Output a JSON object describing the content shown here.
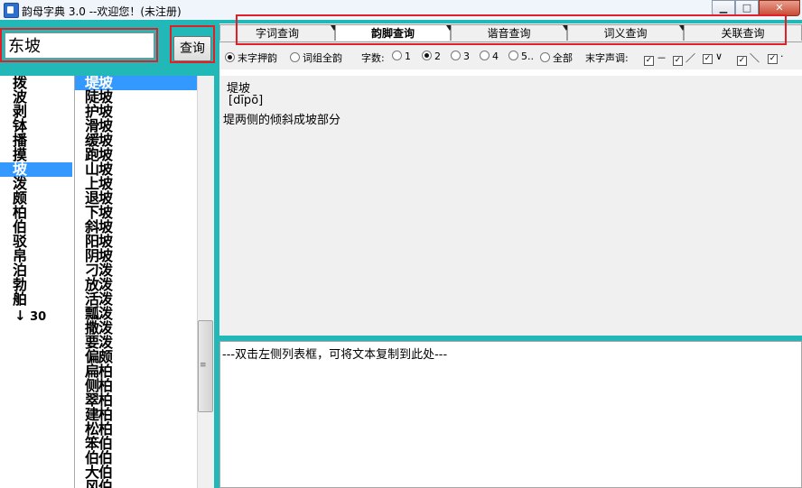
{
  "window": {
    "title": "韵母字典 3.0 --欢迎您！(未注册)",
    "controls": {
      "minimize": "▁",
      "maximize": "□",
      "close": "✕"
    }
  },
  "search": {
    "value": "东坡",
    "button_label": "查询"
  },
  "tabs": [
    {
      "label": "字词查询",
      "active": false
    },
    {
      "label": "韵脚查询",
      "active": true
    },
    {
      "label": "谐音查询",
      "active": false
    },
    {
      "label": "词义查询",
      "active": false
    },
    {
      "label": "关联查询",
      "active": false
    }
  ],
  "options": {
    "rhyme_mode": [
      {
        "label": "末字押韵",
        "selected": true
      },
      {
        "label": "词组全韵",
        "selected": false
      }
    ],
    "char_count_label": "字数:",
    "char_count": [
      {
        "label": "1",
        "selected": false
      },
      {
        "label": "2",
        "selected": true
      },
      {
        "label": "3",
        "selected": false
      },
      {
        "label": "4",
        "selected": false
      },
      {
        "label": "5..",
        "selected": false
      },
      {
        "label": "全部",
        "selected": false
      }
    ],
    "tone_label": "末字声调:",
    "tones": [
      {
        "symbol": "－",
        "checked": true
      },
      {
        "symbol": "／",
        "checked": true
      },
      {
        "symbol": "∨",
        "checked": true
      },
      {
        "symbol": "＼",
        "checked": true
      },
      {
        "symbol": "·",
        "checked": true
      }
    ]
  },
  "rhyme_list": {
    "items": [
      "拨",
      "波",
      "剥",
      "钵",
      "播",
      "摸",
      "坡",
      "泼",
      "颇",
      "柏",
      "伯",
      "驳",
      "帛",
      "泊",
      "勃",
      "舶"
    ],
    "selected_index": 6,
    "more_label": "30"
  },
  "word_list": {
    "items": [
      "堤坡",
      "陡坡",
      "护坡",
      "滑坡",
      "缓坡",
      "跑坡",
      "山坡",
      "上坡",
      "退坡",
      "下坡",
      "斜坡",
      "阳坡",
      "阴坡",
      "刁泼",
      "放泼",
      "活泼",
      "瓢泼",
      "撒泼",
      "要泼",
      "偏颇",
      "扁柏",
      "侧柏",
      "翠柏",
      "建柏",
      "松柏",
      "笨伯",
      "伯伯",
      "大伯",
      "风伯"
    ],
    "selected_index": 0
  },
  "detail": {
    "word": "堤坡",
    "pinyin": "[dīpō]",
    "definition": "堤两侧的倾斜成坡部分"
  },
  "notes": {
    "text": "---双击左侧列表框，可将文本复制到此处---"
  },
  "colors": {
    "frame_teal": "#22b8b8",
    "selection_blue": "#3399ff",
    "highlight_red": "#e21f26"
  }
}
